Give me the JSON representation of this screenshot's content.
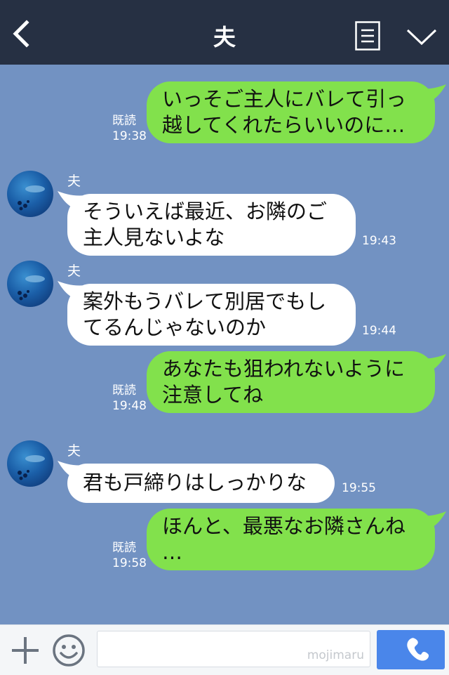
{
  "header": {
    "title": "夫"
  },
  "messages": [
    {
      "side": "me",
      "lines": [
        "いっそご主人にバレて引っ",
        "越してくれたらいいのに…"
      ],
      "read": "既読",
      "time": "19:38"
    },
    {
      "side": "them",
      "sender": "夫",
      "lines": [
        "そういえば最近、お隣のご",
        "主人見ないよな"
      ],
      "time": "19:43"
    },
    {
      "side": "them",
      "sender": "夫",
      "lines": [
        "案外もうバレて別居でもし",
        "てるんじゃないのか"
      ],
      "time": "19:44"
    },
    {
      "side": "me",
      "lines": [
        "あなたも狙われないように",
        "注意してね"
      ],
      "read": "既読",
      "time": "19:48"
    },
    {
      "side": "them",
      "sender": "夫",
      "lines": [
        "君も戸締りはしっかりな"
      ],
      "time": "19:55"
    },
    {
      "side": "me",
      "lines": [
        "ほんと、最悪なお隣さんね",
        "…"
      ],
      "read": "既読",
      "time": "19:58"
    }
  ],
  "footer": {
    "watermark": "mojimaru"
  },
  "colors": {
    "header_bg": "#263043",
    "chat_bg": "#7292c2",
    "my_bubble": "#82e14c",
    "their_bubble": "#ffffff",
    "call_button": "#4a86ea"
  },
  "icons": {
    "back": "chevron-left-icon",
    "menu": "menu-list-icon",
    "collapse": "chevron-down-icon",
    "add": "plus-icon",
    "emoji": "smiley-icon",
    "call": "phone-icon"
  }
}
